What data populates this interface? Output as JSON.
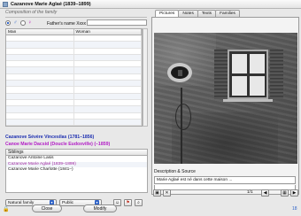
{
  "window": {
    "title": "Cazanove Marie Aglaé (1839–1899)"
  },
  "left": {
    "section_label": "Composition of the family",
    "sex_icons": [
      "♂",
      "♀"
    ],
    "father_name_label": "Father's name Xxxx",
    "grid": {
      "col_man": "Man",
      "col_woman": "Woman"
    },
    "father": "Cazanove Sévère Vincesilas (1781–1856)",
    "mother": "Canoe Marie Dacsid (Doucle Eudoxville) (–1859)",
    "siblings": {
      "header": "Siblings",
      "items": [
        {
          "text": "Cazanove Antoine Lasis",
          "selected": false
        },
        {
          "text": "Cazanove Marie Aglaé (1839–1899)",
          "selected": true
        },
        {
          "text": "Cazanove Marie Charlotte (1841–)",
          "selected": false
        }
      ]
    },
    "family_type": "Natural family",
    "visibility": "Public"
  },
  "right": {
    "tabs": [
      "Pictures",
      "Notes",
      "Texts",
      "Families"
    ],
    "active_tab": "Pictures",
    "description_label": "Description & Source",
    "description_value": "Marie Aglaé est né dans cette maison ...",
    "page_indicator": "1/1"
  },
  "footer": {
    "close_label": "Close",
    "modify_label": "Modify",
    "count": "18"
  }
}
